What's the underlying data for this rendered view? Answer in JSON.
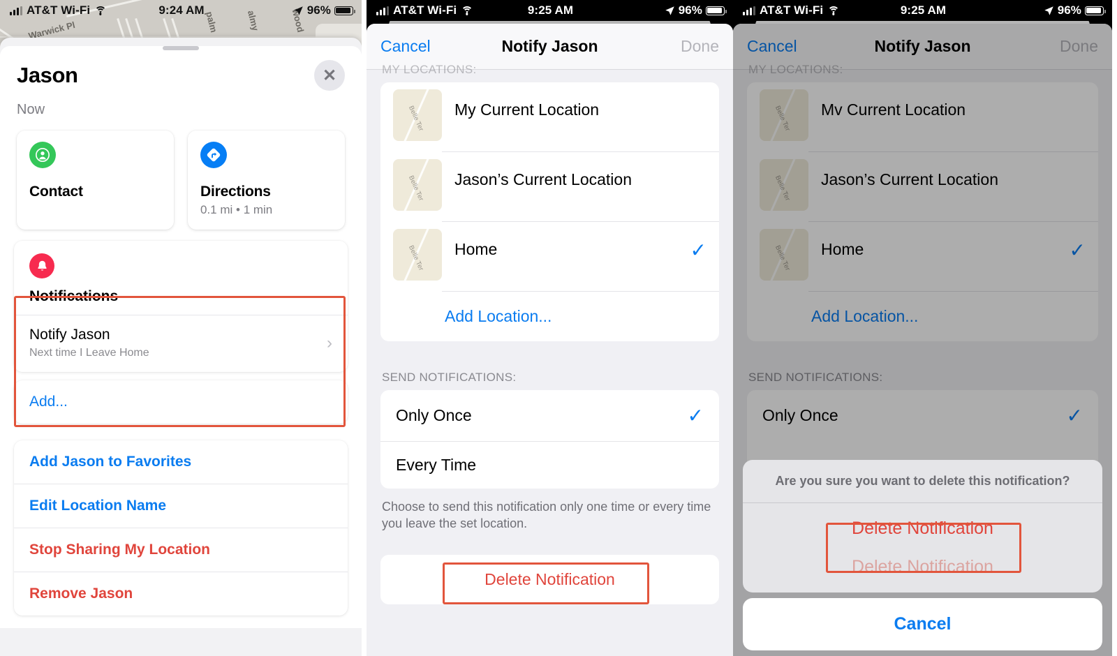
{
  "panel1": {
    "status": {
      "carrier": "AT&T Wi-Fi",
      "time": "9:24 AM",
      "battery": "96%"
    },
    "map_labels": [
      "Warwick Pl",
      "palm",
      "almy",
      "wood"
    ],
    "sheet": {
      "title": "Jason",
      "close_icon": "close-icon",
      "timestamp": "Now",
      "cards": [
        {
          "icon": "contact-icon",
          "label": "Contact",
          "sub": ""
        },
        {
          "icon": "directions-icon",
          "label": "Directions",
          "sub": "0.1 mi • 1 min"
        }
      ],
      "notifications": {
        "icon": "bell-icon",
        "header": "Notifications",
        "row_title": "Notify Jason",
        "row_subtitle": "Next time I Leave Home",
        "chevron": "chevron-right-icon"
      },
      "add_label": "Add...",
      "actions": [
        {
          "label": "Add Jason to Favorites",
          "style": "blue"
        },
        {
          "label": "Edit Location Name",
          "style": "blue"
        },
        {
          "label": "Stop Sharing My Location",
          "style": "red"
        },
        {
          "label": "Remove Jason",
          "style": "red"
        }
      ]
    }
  },
  "panel2": {
    "status": {
      "carrier": "AT&T Wi-Fi",
      "time": "9:25 AM",
      "battery": "96%"
    },
    "nav": {
      "cancel": "Cancel",
      "title": "Notify Jason",
      "done": "Done"
    },
    "locations_header": "MY LOCATIONS:",
    "locations": [
      {
        "name": "My Current Location",
        "thumb_label": "Belle Ter",
        "selected": false
      },
      {
        "name": "Jason’s Current Location",
        "thumb_label": "Belle Ter",
        "selected": false
      },
      {
        "name": "Home",
        "thumb_label": "Belle Ter",
        "selected": true
      }
    ],
    "add_location": "Add Location...",
    "send_header": "SEND NOTIFICATIONS:",
    "send_options": [
      {
        "label": "Only Once",
        "selected": true
      },
      {
        "label": "Every Time",
        "selected": false
      }
    ],
    "footnote": "Choose to send this notification only one time or every time you leave the set location.",
    "delete_label": "Delete Notification"
  },
  "panel3": {
    "status": {
      "carrier": "AT&T Wi-Fi",
      "time": "9:25 AM",
      "battery": "96%"
    },
    "nav": {
      "cancel": "Cancel",
      "title": "Notify Jason",
      "done": "Done"
    },
    "locations_header": "MY LOCATIONS:",
    "locations": [
      {
        "name": "Mv Current Location",
        "thumb_label": "Belle Ter",
        "selected": false
      },
      {
        "name": "Jason’s Current Location",
        "thumb_label": "Belle Ter",
        "selected": false
      },
      {
        "name": "Home",
        "thumb_label": "Belle Ter",
        "selected": true
      }
    ],
    "add_location": "Add Location...",
    "send_header": "SEND NOTIFICATIONS:",
    "send_options": [
      {
        "label": "Only Once",
        "selected": true
      }
    ],
    "action_sheet": {
      "message": "Are you sure you want to delete this notification?",
      "destructive": "Delete Notification",
      "ghost_item": "Delete Notification",
      "cancel": "Cancel"
    }
  },
  "colors": {
    "accent_blue": "#0a7cf0",
    "destructive_red": "#e0453c",
    "bell_red": "#f72b4f",
    "contact_green": "#34c759",
    "directions_blue": "#067ef5",
    "highlight_box": "#e2553c"
  }
}
